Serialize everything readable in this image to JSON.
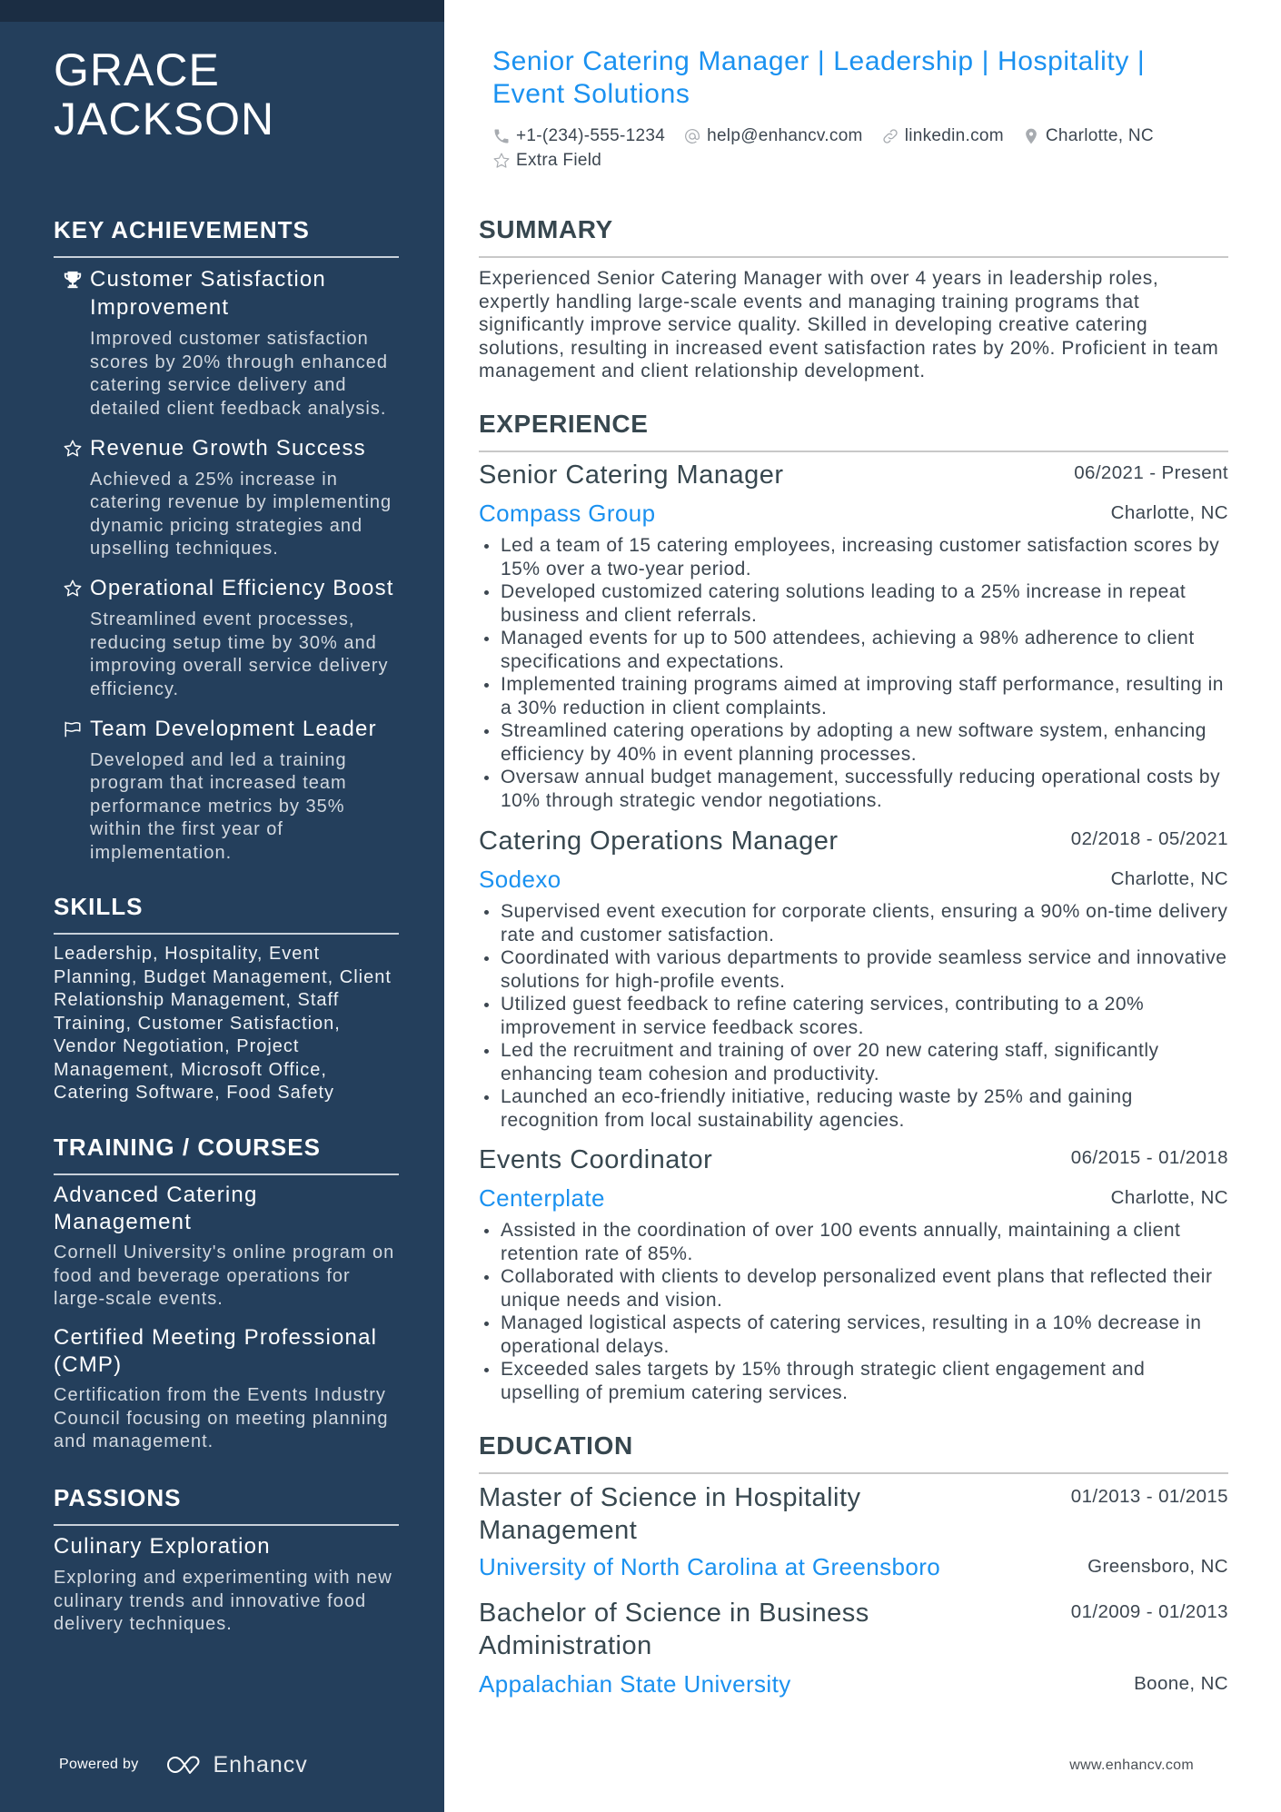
{
  "profile": {
    "name_line1": "GRACE",
    "name_line2": "JACKSON",
    "headline": "Senior Catering Manager | Leadership | Hospitality | Event Solutions",
    "contacts": {
      "phone": "+1-(234)-555-1234",
      "email": "help@enhancv.com",
      "linkedin": "linkedin.com",
      "location": "Charlotte, NC",
      "extra": "Extra Field"
    }
  },
  "sidebar": {
    "achievements": {
      "heading": "KEY ACHIEVEMENTS",
      "items": [
        {
          "icon": "trophy-icon",
          "title": "Customer Satisfaction Improvement",
          "desc": "Improved customer satisfaction scores by 20% through enhanced catering service delivery and detailed client feedback analysis."
        },
        {
          "icon": "star-icon",
          "title": "Revenue Growth Success",
          "desc": "Achieved a 25% increase in catering revenue by implementing dynamic pricing strategies and upselling techniques."
        },
        {
          "icon": "star-icon",
          "title": "Operational Efficiency Boost",
          "desc": "Streamlined event processes, reducing setup time by 30% and improving overall service delivery efficiency."
        },
        {
          "icon": "flag-icon",
          "title": "Team Development Leader",
          "desc": "Developed and led a training program that increased team performance metrics by 35% within the first year of implementation."
        }
      ]
    },
    "skills": {
      "heading": "SKILLS",
      "text": "Leadership, Hospitality, Event Planning, Budget Management, Client Relationship Management, Staff Training, Customer Satisfaction, Vendor Negotiation, Project Management, Microsoft Office, Catering Software, Food Safety"
    },
    "training": {
      "heading": "TRAINING / COURSES",
      "items": [
        {
          "title": "Advanced Catering Management",
          "desc": "Cornell University's online program on food and beverage operations for large-scale events."
        },
        {
          "title": "Certified Meeting Professional (CMP)",
          "desc": "Certification from the Events Industry Council focusing on meeting planning and management."
        }
      ]
    },
    "passions": {
      "heading": "PASSIONS",
      "items": [
        {
          "title": "Culinary Exploration",
          "desc": "Exploring and experimenting with new culinary trends and innovative food delivery techniques."
        }
      ]
    },
    "footer": {
      "powered_by": "Powered by",
      "brand": "Enhancv"
    }
  },
  "main": {
    "summary": {
      "heading": "SUMMARY",
      "text": "Experienced Senior Catering Manager with over 4 years in leadership roles, expertly handling large-scale events and managing training programs that significantly improve service quality. Skilled in developing creative catering solutions, resulting in increased event satisfaction rates by 20%. Proficient in team management and client relationship development."
    },
    "experience": {
      "heading": "EXPERIENCE",
      "jobs": [
        {
          "title": "Senior Catering Manager",
          "dates": "06/2021 - Present",
          "company": "Compass Group",
          "location": "Charlotte, NC",
          "bullets": [
            "Led a team of 15 catering employees, increasing customer satisfaction scores by 15% over a two-year period.",
            "Developed customized catering solutions leading to a 25% increase in repeat business and client referrals.",
            "Managed events for up to 500 attendees, achieving a 98% adherence to client specifications and expectations.",
            "Implemented training programs aimed at improving staff performance, resulting in a 30% reduction in client complaints.",
            "Streamlined catering operations by adopting a new software system, enhancing efficiency by 40% in event planning processes.",
            "Oversaw annual budget management, successfully reducing operational costs by 10% through strategic vendor negotiations."
          ]
        },
        {
          "title": "Catering Operations Manager",
          "dates": "02/2018 - 05/2021",
          "company": "Sodexo",
          "location": "Charlotte, NC",
          "bullets": [
            "Supervised event execution for corporate clients, ensuring a 90% on-time delivery rate and customer satisfaction.",
            "Coordinated with various departments to provide seamless service and innovative solutions for high-profile events.",
            "Utilized guest feedback to refine catering services, contributing to a 20% improvement in service feedback scores.",
            "Led the recruitment and training of over 20 new catering staff, significantly enhancing team cohesion and productivity.",
            "Launched an eco-friendly initiative, reducing waste by 25% and gaining recognition from local sustainability agencies."
          ]
        },
        {
          "title": "Events Coordinator",
          "dates": "06/2015 - 01/2018",
          "company": "Centerplate",
          "location": "Charlotte, NC",
          "bullets": [
            "Assisted in the coordination of over 100 events annually, maintaining a client retention rate of 85%.",
            "Collaborated with clients to develop personalized event plans that reflected their unique needs and vision.",
            "Managed logistical aspects of catering services, resulting in a 10% decrease in operational delays.",
            "Exceeded sales targets by 15% through strategic client engagement and upselling of premium catering services."
          ]
        }
      ]
    },
    "education": {
      "heading": "EDUCATION",
      "items": [
        {
          "degree": "Master of Science in Hospitality Management",
          "dates": "01/2013 - 01/2015",
          "school": "University of North Carolina at Greensboro",
          "location": "Greensboro, NC"
        },
        {
          "degree": "Bachelor of Science in Business Administration",
          "dates": "01/2009 - 01/2013",
          "school": "Appalachian State University",
          "location": "Boone, NC"
        }
      ]
    },
    "footer_site": "www.enhancv.com"
  },
  "colors": {
    "sidebar_bg": "#243f5c",
    "sidebar_top_band": "#1b2d43",
    "accent_blue": "#1a91f0",
    "heading_text": "#37474f",
    "body_text": "#3c4650"
  }
}
